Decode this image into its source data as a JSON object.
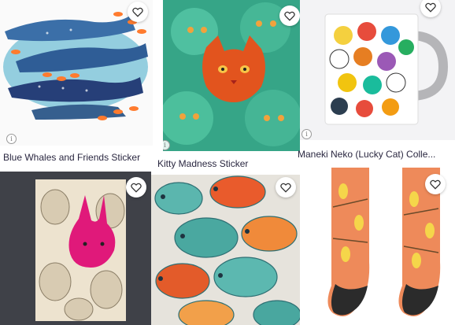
{
  "products": [
    {
      "title": "Blue Whales and Friends Sticker"
    },
    {
      "title": "Kitty Madness Sticker"
    },
    {
      "title": "Maneki Neko (Lucky Cat) Colle..."
    },
    {
      "title": ""
    },
    {
      "title": ""
    },
    {
      "title": ""
    }
  ],
  "icons": {
    "favorite": "heart-outline-icon",
    "info": "info-icon"
  },
  "colors": {
    "title_text": "#2a2740"
  }
}
